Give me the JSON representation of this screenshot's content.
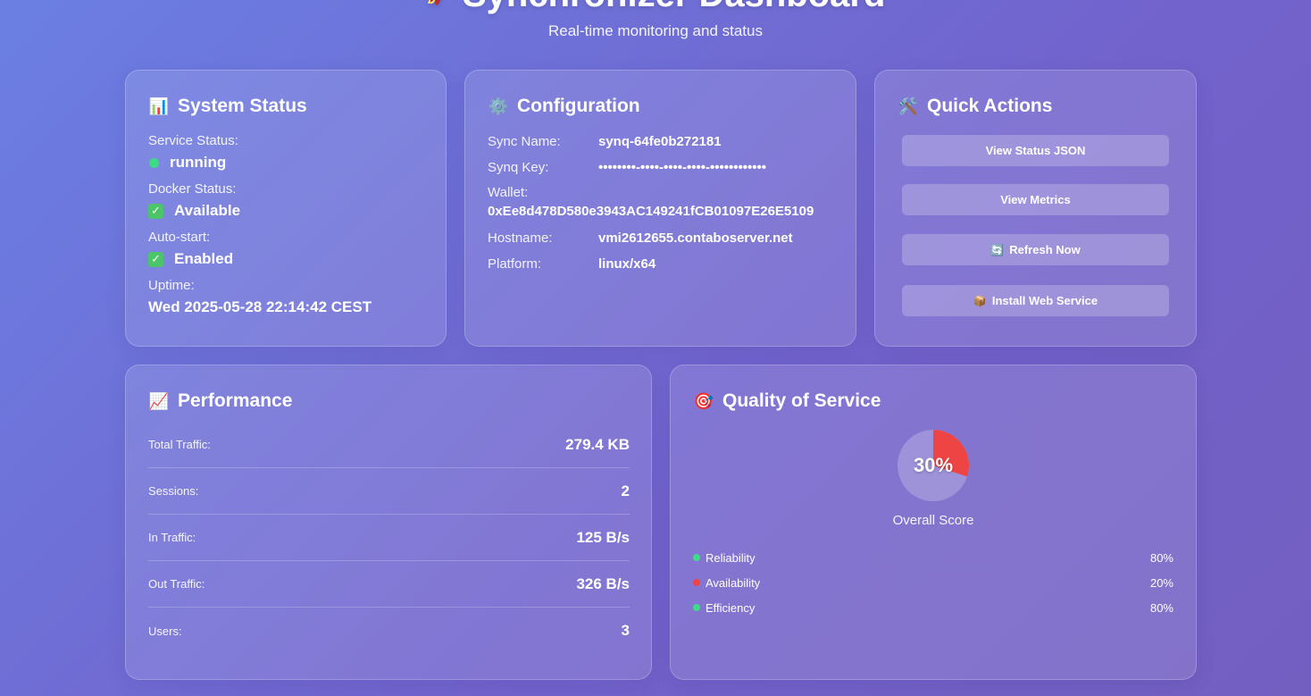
{
  "header": {
    "title": "Synchronizer Dashboard",
    "subtitle": "Real-time monitoring and status"
  },
  "system_status": {
    "title": "System Status",
    "service_label": "Service Status:",
    "service_value": "running",
    "docker_label": "Docker Status:",
    "docker_value": "Available",
    "autostart_label": "Auto-start:",
    "autostart_value": "Enabled",
    "uptime_label": "Uptime:",
    "uptime_value": "Wed 2025-05-28 22:14:42 CEST"
  },
  "configuration": {
    "title": "Configuration",
    "sync_name_label": "Sync Name:",
    "sync_name_value": "synq-64fe0b272181",
    "synq_key_label": "Synq Key:",
    "synq_key_value": "••••••••-••••-••••-••••-••••••••••••",
    "wallet_label": "Wallet:",
    "wallet_value": "0xEe8d478D580e3943AC149241fCB01097E26E5109",
    "hostname_label": "Hostname:",
    "hostname_value": "vmi2612655.contaboserver.net",
    "platform_label": "Platform:",
    "platform_value": "linux/x64"
  },
  "quick_actions": {
    "title": "Quick Actions",
    "buttons": [
      {
        "label": "View Status JSON",
        "icon": ""
      },
      {
        "label": "View Metrics",
        "icon": ""
      },
      {
        "label": "Refresh Now",
        "icon": "refresh-icon"
      },
      {
        "label": "Install Web Service",
        "icon": "package-icon"
      }
    ]
  },
  "performance": {
    "title": "Performance",
    "rows": [
      {
        "label": "Total Traffic:",
        "value": "279.4 KB"
      },
      {
        "label": "Sessions:",
        "value": "2"
      },
      {
        "label": "In Traffic:",
        "value": "125 B/s"
      },
      {
        "label": "Out Traffic:",
        "value": "326 B/s"
      },
      {
        "label": "Users:",
        "value": "3"
      }
    ]
  },
  "quality": {
    "title": "Quality of Service",
    "score_percent": 30,
    "score_label": "30%",
    "score_caption": "Overall Score",
    "metrics": [
      {
        "name": "Reliability",
        "value": "80%",
        "status_color": "#3ddc84"
      },
      {
        "name": "Availability",
        "value": "20%",
        "status_color": "#ef4444"
      },
      {
        "name": "Efficiency",
        "value": "80%",
        "status_color": "#3ddc84"
      }
    ]
  },
  "colors": {
    "accent_green": "#3ddc84",
    "accent_red": "#ef4444"
  }
}
